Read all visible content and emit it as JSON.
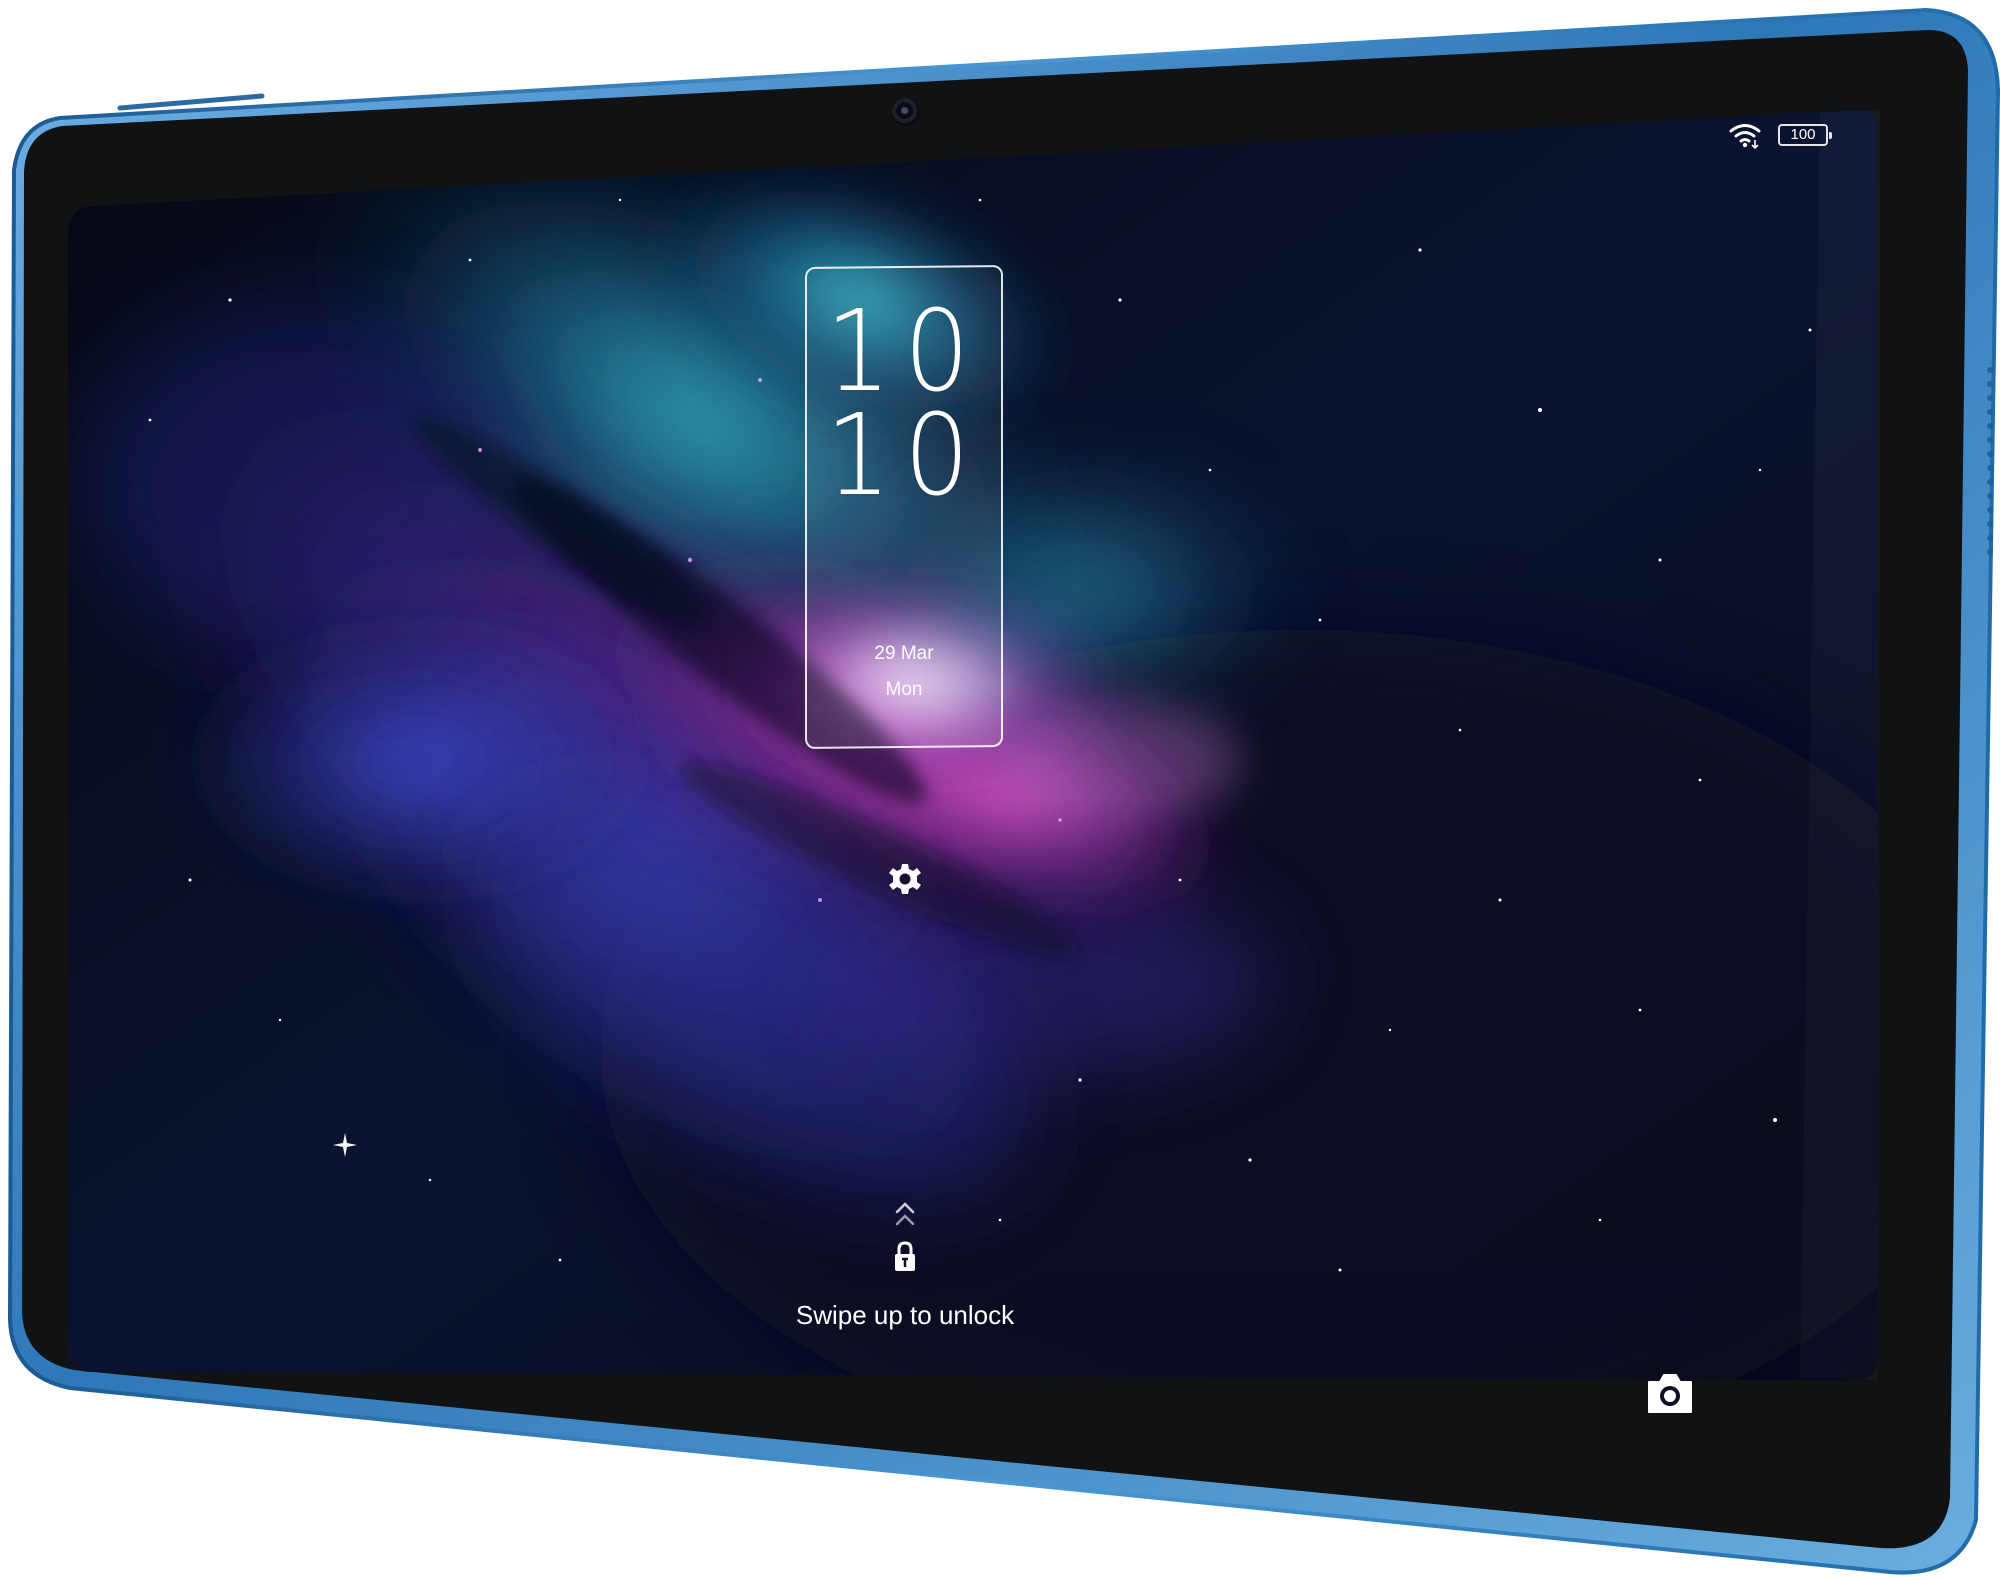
{
  "device": {
    "frame_color": "#3f8ac9",
    "bezel_color": "#111214"
  },
  "status_bar": {
    "wifi_icon": "wifi-icon",
    "battery_level": "100"
  },
  "lock_screen": {
    "clock": {
      "hours": "10",
      "minutes": "10",
      "date": "29 Mar",
      "weekday": "Mon"
    },
    "settings_icon": "gear-icon",
    "swipe_icon": "chevron-up-icon",
    "lock_icon": "lock-icon",
    "unlock_hint": "Swipe up to unlock",
    "camera_icon": "camera-icon"
  }
}
